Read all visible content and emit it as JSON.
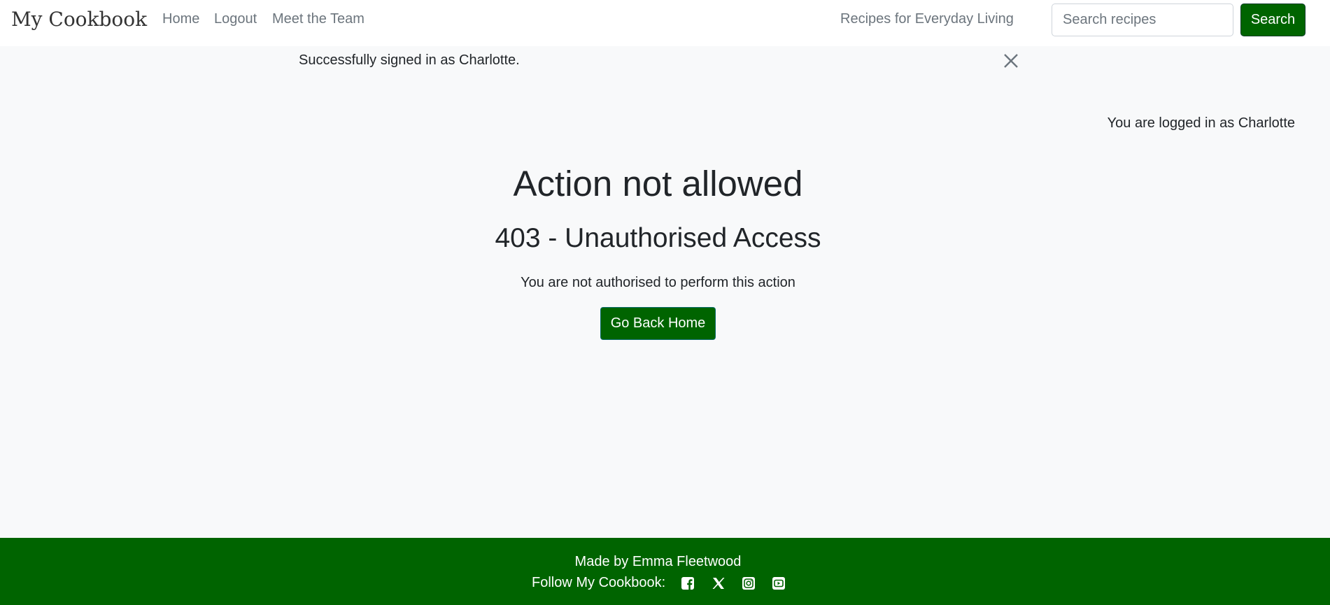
{
  "header": {
    "brand": "My Cookbook",
    "nav": {
      "home": "Home",
      "logout": "Logout",
      "team": "Meet the Team"
    },
    "tagline": "Recipes for Everyday Living",
    "search": {
      "placeholder": "Search recipes",
      "value": "",
      "button_label": "Search"
    }
  },
  "alert": {
    "message": "Successfully signed in as Charlotte."
  },
  "status": {
    "logged_in_text": "You are logged in as Charlotte"
  },
  "main": {
    "title": "Action not allowed",
    "subtitle": "403 - Unauthorised Access",
    "message": "You are not authorised to perform this action",
    "button_label": "Go Back Home"
  },
  "footer": {
    "made_by": "Made by Emma Fleetwood",
    "follow_label": "Follow My Cookbook:",
    "social_icons": [
      "facebook-icon",
      "x-icon",
      "instagram-icon",
      "youtube-icon"
    ]
  },
  "colors": {
    "brand_green": "#006400",
    "background": "#f8f9fa",
    "text": "#212529",
    "muted": "#6c757d"
  }
}
